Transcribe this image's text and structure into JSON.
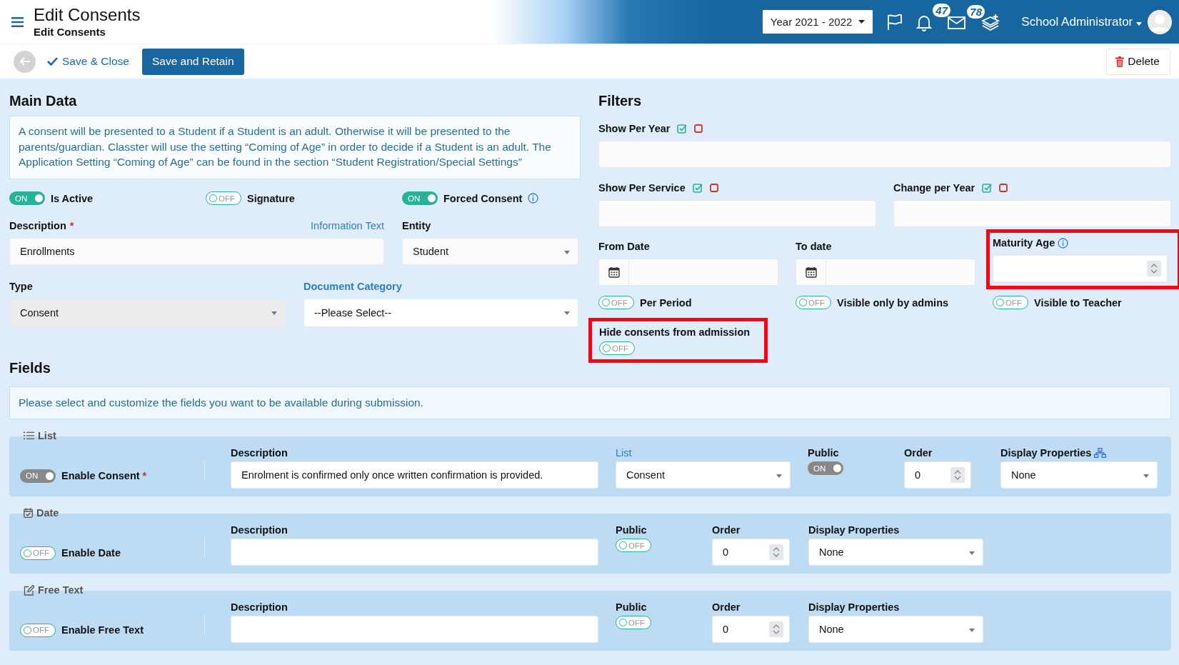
{
  "header": {
    "title": "Edit Consents",
    "subtitle": "Edit Consents",
    "year": "Year 2021 - 2022",
    "notifications": "47",
    "messages": "78",
    "user": "School Administrator"
  },
  "toolbar": {
    "save_close": "Save & Close",
    "save_retain": "Save and Retain",
    "delete": "Delete"
  },
  "main_data": {
    "heading": "Main Data",
    "info": "A consent will be presented to a Student if a Student is an adult. Otherwise it will be presented to the parents/guardian. Classter will use the setting “Coming of Age” in order to decide if a Student is an adult. The Application Setting “Coming of Age” can be found in the section “Student Registration/Special Settings”",
    "switches": [
      {
        "label": "Is Active",
        "text": "ON",
        "on": true,
        "info": false
      },
      {
        "label": "Signature",
        "text": "OFF",
        "on": false,
        "info": false
      },
      {
        "label": "Forced Consent",
        "text": "ON",
        "on": true,
        "info": true
      }
    ],
    "description": {
      "label": "Description",
      "required_mark": "*",
      "link": "Information Text",
      "value": "Enrollments"
    },
    "entity": {
      "label": "Entity",
      "value": "Student"
    },
    "type": {
      "label": "Type",
      "value": "Consent",
      "disabled": true
    },
    "document_category": {
      "label": "Document Category",
      "value": "--Please Select--"
    }
  },
  "filters": {
    "heading": "Filters",
    "pickers": [
      [
        {
          "label": "Show Per Year"
        }
      ],
      [
        {
          "label": "Show Per Service"
        },
        {
          "label": "Change per Year"
        }
      ]
    ],
    "dates": [
      {
        "label": "From Date"
      },
      {
        "label": "To date"
      }
    ],
    "maturity_age": {
      "label": "Maturity Age",
      "highlighted": true
    },
    "switches": [
      {
        "label": "Per Period",
        "text": "OFF",
        "on": false
      },
      {
        "label": "Visible only by admins",
        "text": "OFF",
        "on": false
      },
      {
        "label": "Visible to Teacher",
        "text": "OFF",
        "on": false
      }
    ],
    "hide_consents": {
      "label": "Hide consents from admission",
      "text": "OFF",
      "on": false,
      "highlighted": true
    }
  },
  "fields": {
    "heading": "Fields",
    "hint": "Please select and customize the fields you want to be available during submission.",
    "groups": [
      {
        "kind": "list",
        "title": "List",
        "enable": {
          "label": "Enable Consent",
          "text": "ON",
          "on": true,
          "disabled": true,
          "required_mark": "*"
        },
        "description": {
          "label": "Description",
          "value": "Enrolment is confirmed only once written confirmation is provided."
        },
        "list": {
          "label": "List",
          "value": "Consent"
        },
        "public": {
          "label": "Public",
          "text": "ON",
          "on": true,
          "disabled": true
        },
        "order": {
          "label": "Order",
          "value": "0"
        },
        "display": {
          "label": "Display Properties",
          "value": "None",
          "icon": true
        }
      },
      {
        "kind": "date",
        "title": "Date",
        "enable": {
          "label": "Enable Date",
          "text": "OFF",
          "on": false,
          "disabled": false
        },
        "description": {
          "label": "Description"
        },
        "public": {
          "label": "Public",
          "text": "OFF",
          "on": false,
          "disabled": false
        },
        "order": {
          "label": "Order",
          "value": "0"
        },
        "display": {
          "label": "Display Properties",
          "value": "None",
          "icon": false
        }
      },
      {
        "kind": "free_text",
        "title": "Free Text",
        "enable": {
          "label": "Enable Free Text",
          "text": "OFF",
          "on": false,
          "disabled": false
        },
        "description": {
          "label": "Description"
        },
        "public": {
          "label": "Public",
          "text": "OFF",
          "on": false,
          "disabled": false
        },
        "order": {
          "label": "Order",
          "value": "0"
        },
        "display": {
          "label": "Display Properties",
          "value": "None",
          "icon": false
        }
      }
    ]
  }
}
